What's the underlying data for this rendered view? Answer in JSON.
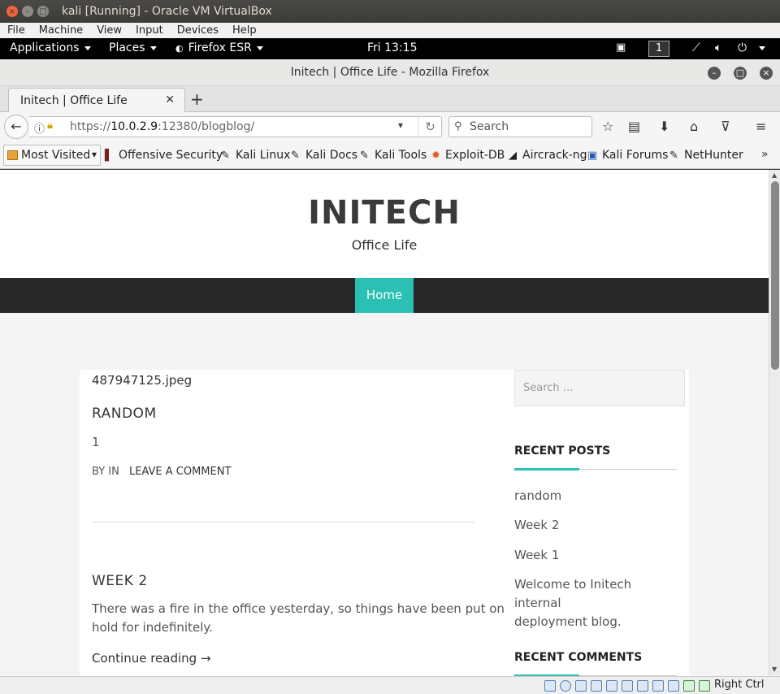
{
  "vbox": {
    "title": "kali [Running] - Oracle VM VirtualBox",
    "menu": [
      "File",
      "Machine",
      "View",
      "Input",
      "Devices",
      "Help"
    ],
    "host_key": "Right Ctrl"
  },
  "gnome": {
    "applications": "Applications",
    "places": "Places",
    "firefox": "Firefox ESR",
    "clock": "Fri 13:15",
    "workspace": "1"
  },
  "firefox": {
    "window_title": "Initech | Office Life - Mozilla Firefox",
    "tab_label": "Initech | Office Life",
    "url_prefix": "https://",
    "url_host": "10.0.2.9",
    "url_rest": ":12380/blogblog/",
    "search_placeholder": "Search",
    "bookmarks": [
      "Most Visited",
      "Offensive Security",
      "Kali Linux",
      "Kali Docs",
      "Kali Tools",
      "Exploit-DB",
      "Aircrack-ng",
      "Kali Forums",
      "NetHunter"
    ],
    "bookmarks_more": "»"
  },
  "site": {
    "title": "INITECH",
    "tagline": "Office Life",
    "nav_home": "Home",
    "post1": {
      "image_text": "487947125.jpeg",
      "title": "RANDOM",
      "body": "1",
      "meta_by": "BY IN",
      "meta_comment": "LEAVE A COMMENT"
    },
    "post2": {
      "title": "WEEK 2",
      "body_line1": "There was a fire in the office yesterday, so things have been put on",
      "body_line2": "hold for indefinitely.",
      "continue": "Continue reading →"
    },
    "sidebar": {
      "search_placeholder": "Search …",
      "recent_posts_heading": "RECENT POSTS",
      "recent_posts": [
        "random",
        "Week 2",
        "Week 1"
      ],
      "welcome_line1": "Welcome to Initech internal",
      "welcome_line2": "deployment blog.",
      "recent_comments_heading": "RECENT COMMENTS"
    }
  },
  "colors": {
    "accent": "#2bc0b4",
    "nav_bg": "#282828",
    "close_btn": "#f0643b"
  }
}
